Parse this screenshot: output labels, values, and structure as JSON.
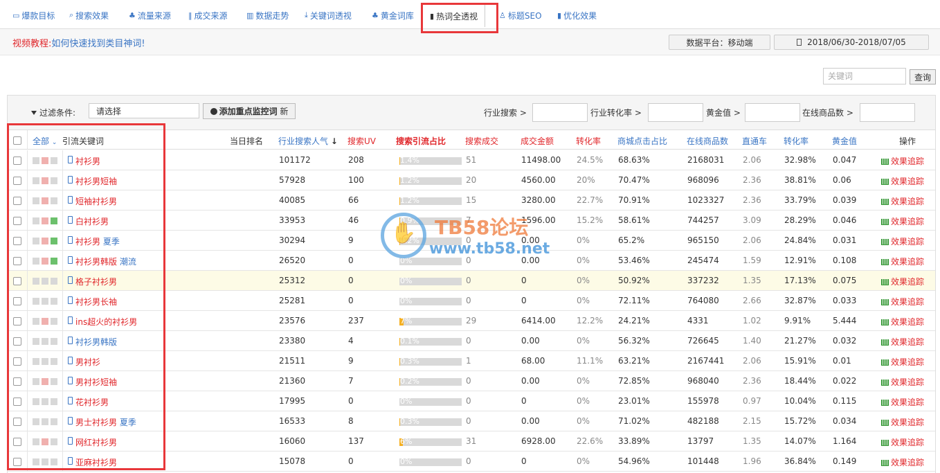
{
  "nav": {
    "tabs": [
      {
        "label": "爆款目标",
        "icon": "monitor-icon"
      },
      {
        "label": "搜索效果",
        "icon": "search-icon"
      },
      {
        "label": "流量来源",
        "icon": "users-icon"
      },
      {
        "label": "成交来源",
        "icon": "cutlery-icon"
      },
      {
        "label": "数据走势",
        "icon": "chart-icon"
      },
      {
        "label": "关键词透视",
        "icon": "download-icon"
      },
      {
        "label": "黄金词库",
        "icon": "users-icon"
      },
      {
        "label": "热词全透视",
        "icon": "bookmark-icon"
      },
      {
        "label": "标题SEO",
        "icon": "user-icon"
      },
      {
        "label": "优化效果",
        "icon": "bookmark-icon"
      }
    ],
    "active_tab": "热词全透视"
  },
  "info": {
    "video_label": "视频教程:",
    "video_link": "如何快速找到类目神词!",
    "platform": "数据平台：移动端",
    "date_range": "2018/06/30-2018/07/05"
  },
  "search": {
    "placeholder": "关键词",
    "button": "查询"
  },
  "filter": {
    "label": "过滤条件:",
    "select_value": "请选择",
    "add_button": "添加重点监控词",
    "add_badge": "新",
    "fields": [
      "行业搜索 >",
      "行业转化率 >",
      "黄金值 >",
      "在线商品数 >"
    ]
  },
  "table": {
    "headers": {
      "all": "全部",
      "keyword": "引流关键词",
      "rank": "当日排名",
      "search_pop": "行业搜索人气",
      "uv": "搜索UV",
      "share": "搜索引流占比",
      "deals": "搜索成交",
      "amount": "成交金额",
      "conv": "转化率",
      "click_share": "商城点击占比",
      "online": "在线商品数",
      "ztc": "直通车",
      "conv2": "转化率",
      "gold": "黄金值",
      "op": "操作"
    },
    "track_label": "效果追踪",
    "colors": {
      "red": "#e0262a",
      "blue": "#3a75c4",
      "bar_fill": "#f5b022",
      "sq_gray": "#d8d8d8",
      "sq_pink": "#f0b0ae",
      "sq_green": "#6cc06c"
    },
    "rows": [
      {
        "kw": "衬衫男",
        "extra": "",
        "kw_blue": false,
        "sq": [
          "g",
          "p",
          "n"
        ],
        "pop": "101172",
        "uv": "208",
        "share": "1.4%",
        "share_pct": 1.4,
        "deals": "51",
        "amount": "11498.00",
        "conv": "24.5%",
        "click": "68.63%",
        "online": "2168031",
        "ztc": "2.06",
        "conv2": "32.98%",
        "gold": "0.047"
      },
      {
        "kw": "衬衫男短袖",
        "extra": "",
        "kw_blue": false,
        "sq": [
          "g",
          "p",
          "n"
        ],
        "pop": "57928",
        "uv": "100",
        "share": "1.2%",
        "share_pct": 1.2,
        "deals": "20",
        "amount": "4560.00",
        "conv": "20%",
        "click": "70.47%",
        "online": "968096",
        "ztc": "2.36",
        "conv2": "38.81%",
        "gold": "0.06"
      },
      {
        "kw": "短袖衬衫男",
        "extra": "",
        "kw_blue": false,
        "sq": [
          "g",
          "p",
          "n"
        ],
        "pop": "40085",
        "uv": "66",
        "share": "1.2%",
        "share_pct": 1.2,
        "deals": "15",
        "amount": "3280.00",
        "conv": "22.7%",
        "click": "70.91%",
        "online": "1023327",
        "ztc": "2.36",
        "conv2": "33.79%",
        "gold": "0.039"
      },
      {
        "kw": "白衬衫男",
        "extra": "",
        "kw_blue": false,
        "sq": [
          "g",
          "p",
          "G"
        ],
        "pop": "33953",
        "uv": "46",
        "share": "0.9%",
        "share_pct": 0.9,
        "deals": "7",
        "amount": "1596.00",
        "conv": "15.2%",
        "click": "58.61%",
        "online": "744257",
        "ztc": "3.09",
        "conv2": "28.29%",
        "gold": "0.046"
      },
      {
        "kw": "衬衫男",
        "extra": "夏季",
        "kw_blue": false,
        "sq": [
          "g",
          "p",
          "G"
        ],
        "pop": "30294",
        "uv": "9",
        "share": "0.2%",
        "share_pct": 0.2,
        "deals": "0",
        "amount": "0.00",
        "conv": "0%",
        "click": "65.2%",
        "online": "965150",
        "ztc": "2.06",
        "conv2": "24.84%",
        "gold": "0.031"
      },
      {
        "kw": "衬衫男韩版",
        "extra": "潮流",
        "kw_blue": false,
        "sq": [
          "g",
          "p",
          "G"
        ],
        "pop": "26520",
        "uv": "0",
        "share": "0%",
        "share_pct": 0,
        "deals": "0",
        "amount": "0.00",
        "conv": "0%",
        "click": "53.46%",
        "online": "245474",
        "ztc": "1.59",
        "conv2": "12.91%",
        "gold": "0.108"
      },
      {
        "kw": "格子衬衫男",
        "extra": "",
        "kw_blue": false,
        "sq": [
          "g",
          "g",
          "n"
        ],
        "pop": "25312",
        "uv": "0",
        "share": "0%",
        "share_pct": 0,
        "deals": "0",
        "amount": "0",
        "conv": "0%",
        "click": "50.92%",
        "online": "337232",
        "ztc": "1.35",
        "conv2": "17.13%",
        "gold": "0.075",
        "highlight": true
      },
      {
        "kw": "衬衫男长袖",
        "extra": "",
        "kw_blue": false,
        "sq": [
          "g",
          "g",
          "n"
        ],
        "pop": "25281",
        "uv": "0",
        "share": "0%",
        "share_pct": 0,
        "deals": "0",
        "amount": "0",
        "conv": "0%",
        "click": "72.11%",
        "online": "764080",
        "ztc": "2.66",
        "conv2": "32.87%",
        "gold": "0.033"
      },
      {
        "kw": "ins超火的衬衫男",
        "extra": "",
        "kw_blue": false,
        "sq": [
          "g",
          "p",
          "n"
        ],
        "pop": "23576",
        "uv": "237",
        "share": "7%",
        "share_pct": 7,
        "deals": "29",
        "amount": "6414.00",
        "conv": "12.2%",
        "click": "24.21%",
        "online": "4331",
        "ztc": "1.02",
        "conv2": "9.91%",
        "gold": "5.444"
      },
      {
        "kw": "衬衫男韩版",
        "extra": "",
        "kw_blue": true,
        "sq": [
          "g",
          "g",
          "n"
        ],
        "pop": "23380",
        "uv": "4",
        "share": "0.1%",
        "share_pct": 0.1,
        "deals": "0",
        "amount": "0.00",
        "conv": "0%",
        "click": "56.32%",
        "online": "726645",
        "ztc": "1.40",
        "conv2": "21.27%",
        "gold": "0.032"
      },
      {
        "kw": "男衬衫",
        "extra": "",
        "kw_blue": false,
        "sq": [
          "g",
          "g",
          "n"
        ],
        "pop": "21511",
        "uv": "9",
        "share": "0.3%",
        "share_pct": 0.3,
        "deals": "1",
        "amount": "68.00",
        "conv": "11.1%",
        "click": "63.21%",
        "online": "2167441",
        "ztc": "2.06",
        "conv2": "15.91%",
        "gold": "0.01"
      },
      {
        "kw": "男衬衫短袖",
        "extra": "",
        "kw_blue": false,
        "sq": [
          "g",
          "p",
          "n"
        ],
        "pop": "21360",
        "uv": "7",
        "share": "0.2%",
        "share_pct": 0.2,
        "deals": "0",
        "amount": "0.00",
        "conv": "0%",
        "click": "72.85%",
        "online": "968040",
        "ztc": "2.36",
        "conv2": "18.44%",
        "gold": "0.022"
      },
      {
        "kw": "花衬衫男",
        "extra": "",
        "kw_blue": false,
        "sq": [
          "g",
          "g",
          "n"
        ],
        "pop": "17995",
        "uv": "0",
        "share": "0%",
        "share_pct": 0,
        "deals": "0",
        "amount": "0",
        "conv": "0%",
        "click": "23.01%",
        "online": "155978",
        "ztc": "0.97",
        "conv2": "10.04%",
        "gold": "0.115"
      },
      {
        "kw": "男士衬衫男",
        "extra": "夏季",
        "kw_blue": false,
        "sq": [
          "g",
          "g",
          "n"
        ],
        "pop": "16533",
        "uv": "8",
        "share": "0.3%",
        "share_pct": 0.3,
        "deals": "0",
        "amount": "0.00",
        "conv": "0%",
        "click": "71.02%",
        "online": "482188",
        "ztc": "2.15",
        "conv2": "15.72%",
        "gold": "0.034"
      },
      {
        "kw": "网红衬衫男",
        "extra": "",
        "kw_blue": false,
        "sq": [
          "g",
          "p",
          "n"
        ],
        "pop": "16060",
        "uv": "137",
        "share": "6%",
        "share_pct": 6,
        "deals": "31",
        "amount": "6928.00",
        "conv": "22.6%",
        "click": "33.89%",
        "online": "13797",
        "ztc": "1.35",
        "conv2": "14.07%",
        "gold": "1.164"
      },
      {
        "kw": "亚麻衬衫男",
        "extra": "",
        "kw_blue": false,
        "sq": [
          "g",
          "g",
          "n"
        ],
        "pop": "15078",
        "uv": "0",
        "share": "0%",
        "share_pct": 0,
        "deals": "0",
        "amount": "0",
        "conv": "0%",
        "click": "54.96%",
        "online": "101448",
        "ztc": "1.96",
        "conv2": "36.84%",
        "gold": "0.149"
      }
    ]
  },
  "watermark": {
    "title": "TB58论坛",
    "url": "www.tb58.net"
  }
}
